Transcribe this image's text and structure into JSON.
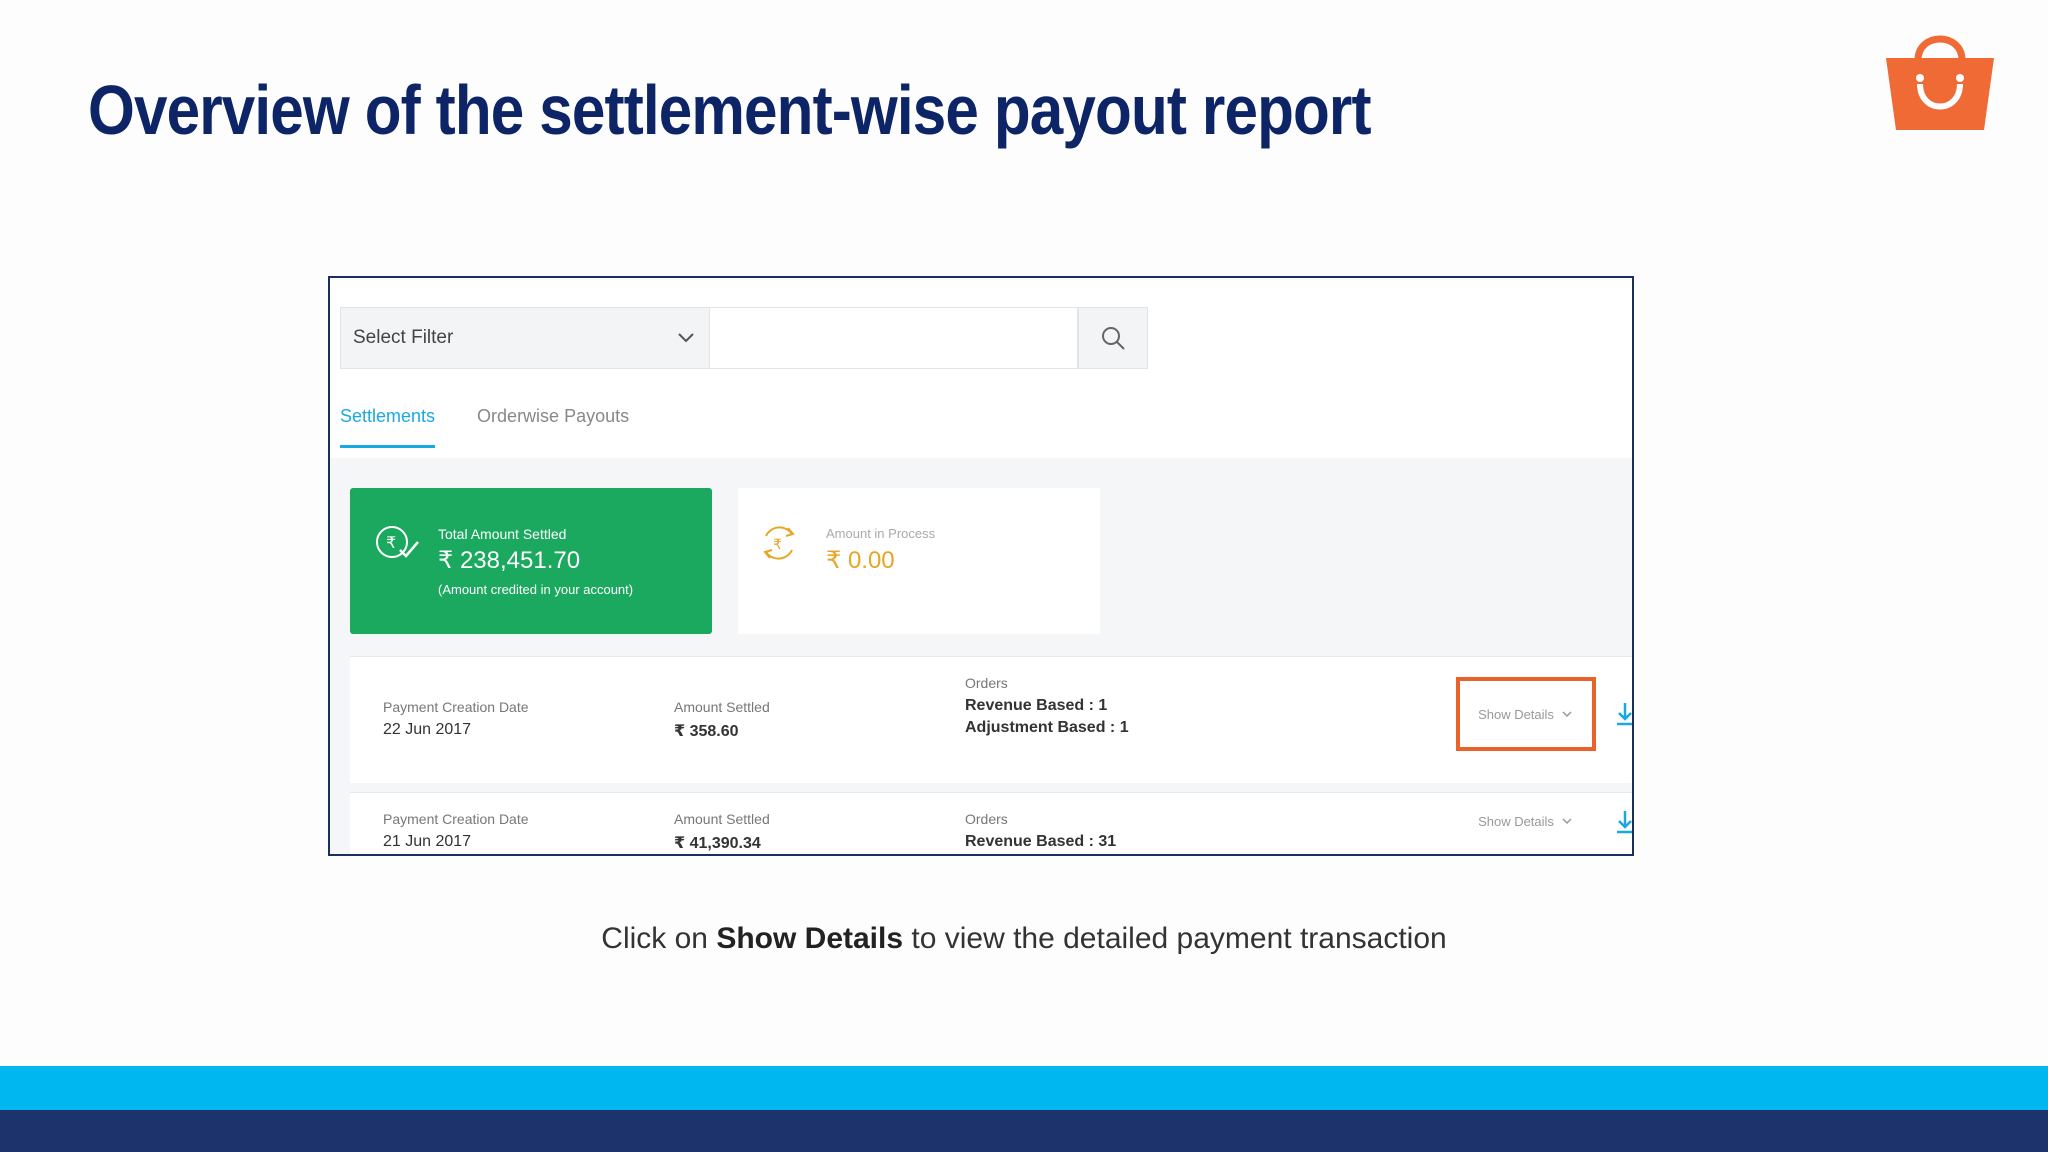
{
  "slide": {
    "title": "Overview of the settlement-wise payout report",
    "caption_prefix": "Click on ",
    "caption_bold": "Show Details",
    "caption_suffix": " to view the detailed payment transaction",
    "logo_icon": "shopping-bag-icon",
    "colors": {
      "title": "#0d2566",
      "logo": "#ef6a35",
      "band_light": "#00b7ef",
      "band_dark": "#1c336b"
    }
  },
  "filter": {
    "select_label": "Select Filter",
    "search_placeholder": ""
  },
  "tabs": [
    {
      "label": "Settlements",
      "active": true
    },
    {
      "label": "Orderwise Payouts",
      "active": false
    }
  ],
  "summary": {
    "settled": {
      "label": "Total Amount Settled",
      "amount": "₹ 238,451.70",
      "note": "(Amount credited in your account)",
      "color": "#1aa95e"
    },
    "in_process": {
      "label": "Amount in Process",
      "amount": "₹ 0.00",
      "color": "#e8a524"
    }
  },
  "settlements": [
    {
      "date_label": "Payment Creation Date",
      "date": "22 Jun 2017",
      "amount_label": "Amount Settled",
      "amount": "₹ 358.60",
      "orders_label": "Orders",
      "orders": [
        "Revenue Based : 1",
        "Adjustment Based : 1"
      ],
      "show_details": "Show Details"
    },
    {
      "date_label": "Payment Creation Date",
      "date": "21 Jun 2017",
      "amount_label": "Amount Settled",
      "amount": "₹ 41,390.34",
      "orders_label": "Orders",
      "orders": [
        "Revenue Based : 31"
      ],
      "show_details": "Show Details"
    }
  ]
}
